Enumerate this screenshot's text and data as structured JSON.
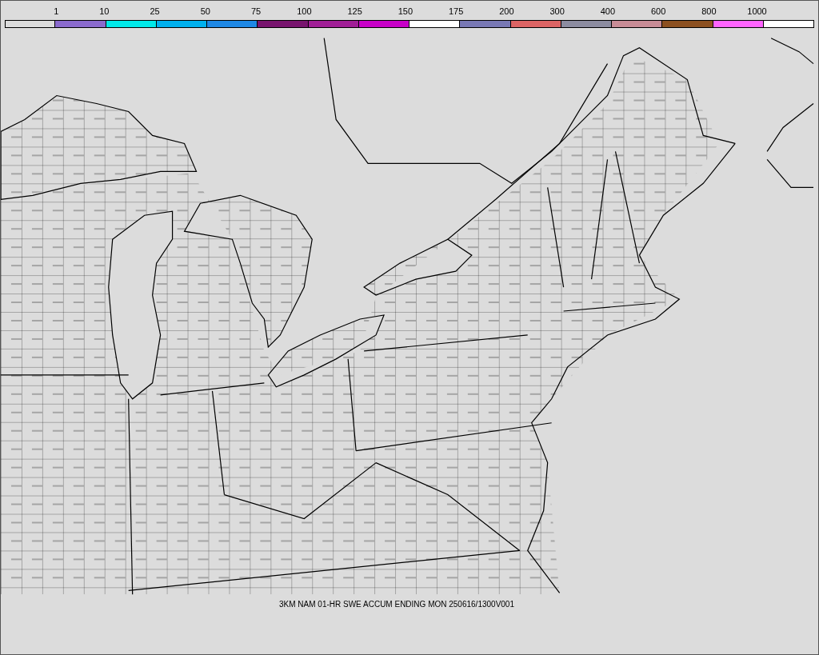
{
  "legend": [
    {
      "label": "1",
      "color": "#dcdcdc"
    },
    {
      "label": "10",
      "color": "#8a6acd"
    },
    {
      "label": "25",
      "color": "#00e8e8"
    },
    {
      "label": "50",
      "color": "#00b0ee"
    },
    {
      "label": "75",
      "color": "#1e88e5"
    },
    {
      "label": "100",
      "color": "#78146e"
    },
    {
      "label": "125",
      "color": "#a01e96"
    },
    {
      "label": "150",
      "color": "#c800c8"
    },
    {
      "label": "175",
      "color": "#ffffff"
    },
    {
      "label": "200",
      "color": "#7878b4"
    },
    {
      "label": "300",
      "color": "#dc6464"
    },
    {
      "label": "400",
      "color": "#8c8ca0"
    },
    {
      "label": "600",
      "color": "#c88c96"
    },
    {
      "label": "800",
      "color": "#8c5020"
    },
    {
      "label": "1000",
      "color": "#ff64ff"
    },
    {
      "color": "#ffffff"
    }
  ],
  "caption": "3KM NAM 01-HR SWE ACCUM ENDING MON 250616/1300V001"
}
